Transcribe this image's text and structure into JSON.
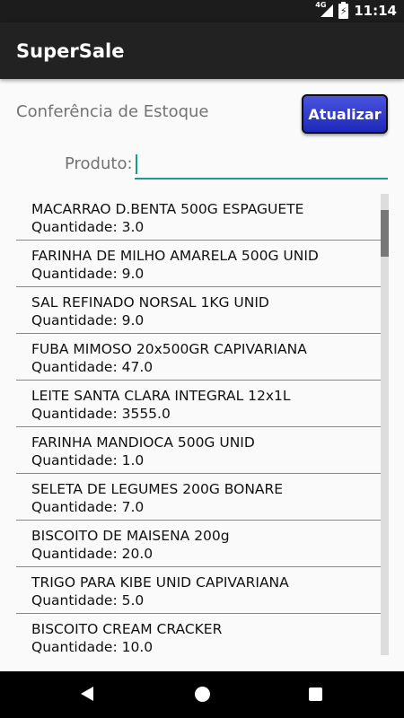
{
  "status": {
    "time": "11:14",
    "network": "4G"
  },
  "app": {
    "title": "SuperSale"
  },
  "header": {
    "section_title": "Conferência de Estoque",
    "refresh_label": "Atualizar"
  },
  "search": {
    "label": "Produto:",
    "value": ""
  },
  "items": [
    {
      "name": "MACARRAO D.BENTA 500G ESPAGUETE",
      "qty": "Quantidade: 3.0"
    },
    {
      "name": "FARINHA DE MILHO AMARELA 500G UNID",
      "qty": "Quantidade: 9.0"
    },
    {
      "name": "SAL REFINADO NORSAL 1KG UNID",
      "qty": "Quantidade: 9.0"
    },
    {
      "name": "FUBA MIMOSO  20x500GR CAPIVARIANA",
      "qty": "Quantidade: 47.0"
    },
    {
      "name": "LEITE SANTA CLARA INTEGRAL 12x1L",
      "qty": "Quantidade: 3555.0"
    },
    {
      "name": "FARINHA MANDIOCA 500G UNID",
      "qty": "Quantidade: 1.0"
    },
    {
      "name": "SELETA DE LEGUMES 200G BONARE",
      "qty": "Quantidade: 7.0"
    },
    {
      "name": "BISCOITO DE MAISENA 200g",
      "qty": "Quantidade: 20.0"
    },
    {
      "name": "TRIGO PARA KIBE UNID CAPIVARIANA",
      "qty": "Quantidade: 5.0"
    },
    {
      "name": "BISCOITO CREAM CRACKER",
      "qty": "Quantidade: 10.0"
    }
  ]
}
